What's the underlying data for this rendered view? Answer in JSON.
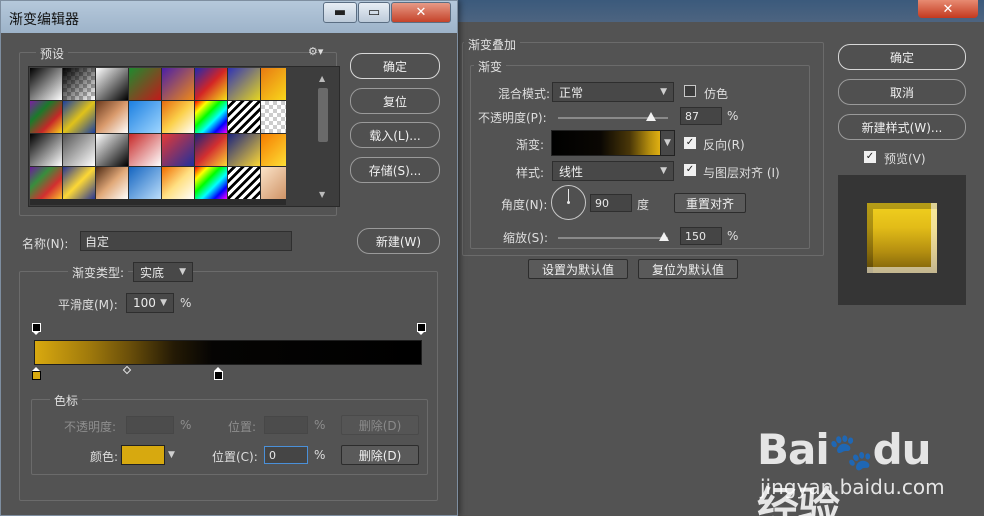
{
  "gradient_editor": {
    "title": "渐变编辑器",
    "window_controls": {
      "minimize": "▬",
      "maximize": "▭",
      "close": "✕"
    },
    "presets_label": "预设",
    "presets_menu_icon": "gear-icon",
    "buttons": {
      "ok": "确定",
      "reset": "复位",
      "load": "载入(L)...",
      "save": "存储(S)...",
      "new": "新建(W)"
    },
    "name_label": "名称(N):",
    "name_value": "自定",
    "gradient_type_label": "渐变类型:",
    "gradient_type_value": "实底",
    "smoothness_label": "平滑度(M):",
    "smoothness_value": "100",
    "percent": "%",
    "color_stops": {
      "group_label": "色标",
      "opacity_label": "不透明度:",
      "opacity_value": "",
      "opacity_location_label": "位置:",
      "opacity_location_value": "",
      "opacity_delete": "删除(D)",
      "color_label": "颜色:",
      "color_value": "#d7a90f",
      "location_label": "位置(C):",
      "location_value": "0",
      "color_delete": "删除(D)"
    }
  },
  "gradient_overlay": {
    "section_title": "渐变叠加",
    "subsection_title": "渐变",
    "blend_mode_label": "混合模式:",
    "blend_mode_value": "正常",
    "dither_label": "仿色",
    "dither_checked": false,
    "opacity_label": "不透明度(P):",
    "opacity_value": "87",
    "opacity_percent": "%",
    "opacity_level": 87,
    "gradient_label": "渐变:",
    "reverse_label": "反向(R)",
    "reverse_checked": true,
    "style_label": "样式:",
    "style_value": "线性",
    "align_label": "与图层对齐 (I)",
    "align_checked": true,
    "angle_label": "角度(N):",
    "angle_value": "90",
    "angle_unit": "度",
    "reset_align_button": "重置对齐",
    "scale_label": "缩放(S):",
    "scale_value": "150",
    "scale_percent": "%",
    "scale_level": 150,
    "set_default_button": "设置为默认值",
    "reset_default_button": "复位为默认值"
  },
  "layer_style_side": {
    "ok": "确定",
    "cancel": "取消",
    "new_style": "新建样式(W)...",
    "preview_label": "预览(V)",
    "preview_checked": true,
    "close_glyph": "✕"
  },
  "watermark": {
    "logo": "Bai du 经验",
    "url": "jingyan.baidu.com"
  },
  "colors": {
    "gold": "#d7a90f",
    "panel": "#535353",
    "title_bar": "#a9bdd1"
  }
}
